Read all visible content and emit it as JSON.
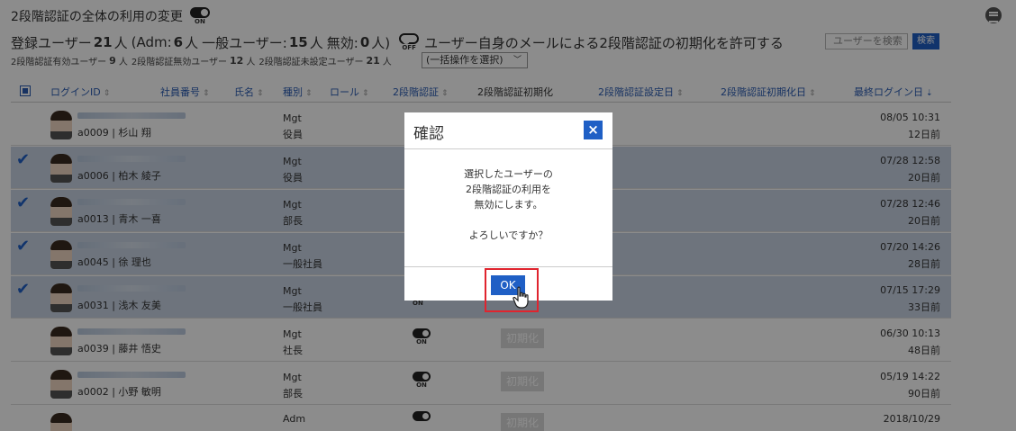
{
  "header": {
    "title": "2段階認証の全体の利用の変更",
    "toggle_state": "ON",
    "counts": {
      "registered_label": "登録ユーザー",
      "registered": "21",
      "unit": "人",
      "adm_label": "(Adm:",
      "adm": "6",
      "general_label": "一般ユーザー:",
      "general": "15",
      "disabled_label": "無効:",
      "disabled": "0",
      "close": "人)"
    },
    "email_toggle_state": "OFF",
    "email_label": "ユーザー自身のメールによる2段階認証の初期化を許可する",
    "search_placeholder": "ユーザーを検索",
    "search_button": "検索",
    "stats": {
      "enabled_label": "2段階認証有効ユーザー",
      "enabled": "9",
      "disabled_label": "2段階認証無効ユーザー",
      "disabled": "12",
      "unset_label": "2段階認証未設定ユーザー",
      "unset": "21",
      "unit": "人"
    },
    "bulk_select": "(一括操作を選択)"
  },
  "table": {
    "columns": [
      "ログインID",
      "社員番号",
      "氏名",
      "種別",
      "ロール",
      "2段階認証",
      "2段階認証初期化",
      "2段階認証設定日",
      "2段階認証初期化日",
      "最終ログイン日"
    ],
    "sort_glyph": "⇕",
    "sort_desc_glyph": "⇣",
    "init_label": "初期化",
    "toggle_on_label": "ON",
    "rows": [
      {
        "user": "a0009 | 杉山 翔",
        "kind": "Mgt",
        "role": "役員",
        "selected": false,
        "last_date": "08/05 10:31",
        "last_ago": "12日前"
      },
      {
        "user": "a0006 | 柏木 綾子",
        "kind": "Mgt",
        "role": "役員",
        "selected": true,
        "last_date": "07/28 12:58",
        "last_ago": "20日前"
      },
      {
        "user": "a0013 | 青木 一喜",
        "kind": "Mgt",
        "role": "部長",
        "selected": true,
        "last_date": "07/28 12:46",
        "last_ago": "20日前"
      },
      {
        "user": "a0045 | 徐 理也",
        "kind": "Mgt",
        "role": "一般社員",
        "selected": true,
        "last_date": "07/20 14:26",
        "last_ago": "28日前"
      },
      {
        "user": "a0031 | 浅木 友美",
        "kind": "Mgt",
        "role": "一般社員",
        "selected": true,
        "last_date": "07/15 17:29",
        "last_ago": "33日前"
      },
      {
        "user": "a0039 | 藤井 悟史",
        "kind": "Mgt",
        "role": "社長",
        "selected": false,
        "last_date": "06/30 10:13",
        "last_ago": "48日前"
      },
      {
        "user": "a0002 | 小野 敏明",
        "kind": "Mgt",
        "role": "部長",
        "selected": false,
        "last_date": "05/19 14:22",
        "last_ago": "90日前"
      },
      {
        "user": "",
        "kind": "Adm",
        "role": "",
        "selected": false,
        "last_date": "2018/10/29",
        "last_ago": ""
      }
    ]
  },
  "modal": {
    "title": "確認",
    "close": "×",
    "line1": "選択したユーザーの",
    "line2": "2段階認証の利用を",
    "line3": "無効にします。",
    "line4": "よろしいですか？",
    "ok": "OK"
  },
  "colors": {
    "accent": "#1f5fc5",
    "highlight": "#e0242e",
    "selected_row": "#c9d4e4"
  }
}
